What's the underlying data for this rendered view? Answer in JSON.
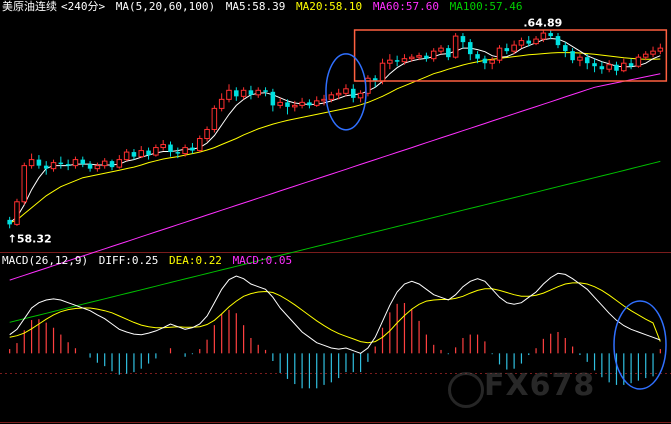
{
  "header": {
    "title": "美原油连续",
    "period": "<240分>",
    "ma_label": "MA(5,20,60,100)",
    "ma5": "MA5:58.39",
    "ma20": "MA20:58.10",
    "ma60": "MA60:57.60",
    "ma100": "MA100:57.46"
  },
  "macd_header": {
    "label": "MACD(26,12,9)",
    "diff": "DIFF:0.25",
    "dea": "DEA:0.22",
    "macd": "MACD:0.05"
  },
  "watermark": "FX678",
  "colors": {
    "up": "#ff3030",
    "down": "#00e0e0",
    "ma5": "#ffffff",
    "ma20": "#ffff00",
    "ma60": "#ff30ff",
    "ma100": "#00c000",
    "highlight_box": "#ff6040",
    "highlight_circle": "#3070ff",
    "macd_neg": "#30c0e0",
    "macd_pos": "#ff4040"
  },
  "chart_data": [
    {
      "type": "candlestick",
      "title": "美原油连续<240分>",
      "annotations": [
        {
          "text": "58.32",
          "kind": "low"
        },
        {
          "text": "64.89",
          "kind": "high"
        }
      ],
      "series": [
        {
          "name": "MA5",
          "value": 58.39
        },
        {
          "name": "MA20",
          "value": 58.1
        },
        {
          "name": "MA60",
          "value": 57.6
        },
        {
          "name": "MA100",
          "value": 57.46
        }
      ],
      "ylim": [
        57.6,
        65.3
      ],
      "candles": [
        [
          58.6,
          58.45,
          58.7,
          58.32
        ],
        [
          58.45,
          59.2,
          59.3,
          58.4
        ],
        [
          59.2,
          60.4,
          60.5,
          59.1
        ],
        [
          60.4,
          60.6,
          60.8,
          60.3
        ],
        [
          60.6,
          60.4,
          60.75,
          60.3
        ],
        [
          60.4,
          60.3,
          60.55,
          60.1
        ],
        [
          60.3,
          60.5,
          60.6,
          60.2
        ],
        [
          60.5,
          60.45,
          60.7,
          60.3
        ],
        [
          60.45,
          60.4,
          60.6,
          60.25
        ],
        [
          60.4,
          60.6,
          60.7,
          60.3
        ],
        [
          60.6,
          60.45,
          60.7,
          60.35
        ],
        [
          60.45,
          60.3,
          60.55,
          60.2
        ],
        [
          60.3,
          60.4,
          60.5,
          60.2
        ],
        [
          60.4,
          60.55,
          60.65,
          60.3
        ],
        [
          60.55,
          60.35,
          60.6,
          60.25
        ],
        [
          60.35,
          60.6,
          60.75,
          60.3
        ],
        [
          60.6,
          60.85,
          60.95,
          60.55
        ],
        [
          60.85,
          60.7,
          60.95,
          60.6
        ],
        [
          60.7,
          60.9,
          61.05,
          60.65
        ],
        [
          60.9,
          60.75,
          61.0,
          60.6
        ],
        [
          60.75,
          61.0,
          61.1,
          60.7
        ],
        [
          61.0,
          61.1,
          61.25,
          60.9
        ],
        [
          61.1,
          60.85,
          61.2,
          60.7
        ],
        [
          60.85,
          60.8,
          61.0,
          60.65
        ],
        [
          60.8,
          61.0,
          61.1,
          60.7
        ],
        [
          61.0,
          60.9,
          61.15,
          60.8
        ],
        [
          60.9,
          61.3,
          61.4,
          60.85
        ],
        [
          61.3,
          61.6,
          61.7,
          61.2
        ],
        [
          61.6,
          62.3,
          62.4,
          61.5
        ],
        [
          62.3,
          62.6,
          62.8,
          62.2
        ],
        [
          62.6,
          62.9,
          63.1,
          62.5
        ],
        [
          62.9,
          62.7,
          63.0,
          62.55
        ],
        [
          62.7,
          62.9,
          63.0,
          62.6
        ],
        [
          62.9,
          62.75,
          63.05,
          62.6
        ],
        [
          62.75,
          62.9,
          63.0,
          62.65
        ],
        [
          62.9,
          62.85,
          63.0,
          62.7
        ],
        [
          62.85,
          62.4,
          62.95,
          62.2
        ],
        [
          62.4,
          62.5,
          62.65,
          62.3
        ],
        [
          62.5,
          62.35,
          62.6,
          62.1
        ],
        [
          62.35,
          62.4,
          62.55,
          62.2
        ],
        [
          62.4,
          62.5,
          62.65,
          62.3
        ],
        [
          62.5,
          62.4,
          62.6,
          62.3
        ],
        [
          62.4,
          62.55,
          62.7,
          62.35
        ],
        [
          62.55,
          62.6,
          62.75,
          62.4
        ],
        [
          62.6,
          62.75,
          62.85,
          62.5
        ],
        [
          62.75,
          62.8,
          62.95,
          62.6
        ],
        [
          62.8,
          62.95,
          63.1,
          62.7
        ],
        [
          62.95,
          62.65,
          63.1,
          62.5
        ],
        [
          62.65,
          62.8,
          62.9,
          62.5
        ],
        [
          62.8,
          63.3,
          63.4,
          62.7
        ],
        [
          63.3,
          63.2,
          63.4,
          63.0
        ],
        [
          63.2,
          63.8,
          63.95,
          63.1
        ],
        [
          63.8,
          63.9,
          64.1,
          63.6
        ],
        [
          63.9,
          63.85,
          64.05,
          63.7
        ],
        [
          63.85,
          63.95,
          64.1,
          63.75
        ],
        [
          63.95,
          64.0,
          64.1,
          63.85
        ],
        [
          64.0,
          64.05,
          64.15,
          63.9
        ],
        [
          64.05,
          63.95,
          64.15,
          63.85
        ],
        [
          63.95,
          64.2,
          64.3,
          63.85
        ],
        [
          64.2,
          64.3,
          64.4,
          64.1
        ],
        [
          64.3,
          64.0,
          64.4,
          63.9
        ],
        [
          64.0,
          64.7,
          64.8,
          63.95
        ],
        [
          64.7,
          64.5,
          64.8,
          64.3
        ],
        [
          64.5,
          64.1,
          64.6,
          63.9
        ],
        [
          64.1,
          63.95,
          64.2,
          63.8
        ],
        [
          63.95,
          63.8,
          64.05,
          63.6
        ],
        [
          63.8,
          63.9,
          64.0,
          63.6
        ],
        [
          63.9,
          64.3,
          64.4,
          63.8
        ],
        [
          64.3,
          64.2,
          64.45,
          64.1
        ],
        [
          64.2,
          64.4,
          64.55,
          64.1
        ],
        [
          64.4,
          64.55,
          64.65,
          64.3
        ],
        [
          64.55,
          64.45,
          64.7,
          64.35
        ],
        [
          64.45,
          64.6,
          64.7,
          64.4
        ],
        [
          64.6,
          64.8,
          64.89,
          64.5
        ],
        [
          64.8,
          64.7,
          64.89,
          64.6
        ],
        [
          64.7,
          64.4,
          64.8,
          64.3
        ],
        [
          64.4,
          64.2,
          64.5,
          64.0
        ],
        [
          64.2,
          63.9,
          64.3,
          63.8
        ],
        [
          63.9,
          64.0,
          64.1,
          63.7
        ],
        [
          64.0,
          63.8,
          64.1,
          63.6
        ],
        [
          63.8,
          63.7,
          63.95,
          63.5
        ],
        [
          63.7,
          63.6,
          63.85,
          63.45
        ],
        [
          63.6,
          63.75,
          63.9,
          63.5
        ],
        [
          63.75,
          63.55,
          63.85,
          63.4
        ],
        [
          63.55,
          63.8,
          63.95,
          63.5
        ],
        [
          63.8,
          63.7,
          63.95,
          63.6
        ],
        [
          63.7,
          64.0,
          64.1,
          63.65
        ],
        [
          64.0,
          64.1,
          64.2,
          63.9
        ],
        [
          64.1,
          64.2,
          64.35,
          64.0
        ],
        [
          64.2,
          64.3,
          64.45,
          64.1
        ]
      ],
      "ma5": [
        58.5,
        58.7,
        59.1,
        59.6,
        60.0,
        60.3,
        60.4,
        60.4,
        60.4,
        60.45,
        60.45,
        60.45,
        60.42,
        60.42,
        60.42,
        60.45,
        60.55,
        60.6,
        60.68,
        60.75,
        60.82,
        60.87,
        60.87,
        60.9,
        60.95,
        60.95,
        61.0,
        61.15,
        61.4,
        61.75,
        62.1,
        62.4,
        62.6,
        62.75,
        62.8,
        62.82,
        62.75,
        62.65,
        62.55,
        62.48,
        62.45,
        62.43,
        62.44,
        62.48,
        62.55,
        62.63,
        62.72,
        62.75,
        62.78,
        62.88,
        63.0,
        63.2,
        63.45,
        63.65,
        63.8,
        63.88,
        63.93,
        63.96,
        64.02,
        64.1,
        64.12,
        64.2,
        64.3,
        64.3,
        64.25,
        64.18,
        64.05,
        64.0,
        64.02,
        64.12,
        64.28,
        64.38,
        64.48,
        64.58,
        64.62,
        64.6,
        64.5,
        64.35,
        64.2,
        64.05,
        63.95,
        63.85,
        63.78,
        63.7,
        63.68,
        63.68,
        63.72,
        63.8,
        63.95,
        64.05
      ],
      "ma20": [
        58.5,
        58.6,
        58.8,
        59.0,
        59.2,
        59.4,
        59.55,
        59.7,
        59.8,
        59.9,
        60.0,
        60.05,
        60.1,
        60.15,
        60.2,
        60.25,
        60.3,
        60.35,
        60.42,
        60.5,
        60.56,
        60.62,
        60.66,
        60.7,
        60.75,
        60.8,
        60.85,
        60.92,
        61.0,
        61.1,
        61.2,
        61.3,
        61.42,
        61.52,
        61.62,
        61.7,
        61.78,
        61.84,
        61.9,
        61.95,
        62.0,
        62.05,
        62.1,
        62.15,
        62.2,
        62.25,
        62.3,
        62.35,
        62.42,
        62.5,
        62.6,
        62.7,
        62.82,
        62.95,
        63.05,
        63.15,
        63.25,
        63.35,
        63.45,
        63.52,
        63.6,
        63.67,
        63.74,
        63.8,
        63.85,
        63.9,
        63.93,
        63.96,
        63.99,
        64.02,
        64.05,
        64.08,
        64.1,
        64.12,
        64.14,
        64.15,
        64.15,
        64.15,
        64.14,
        64.12,
        64.1,
        64.07,
        64.04,
        64.01,
        63.98,
        63.96,
        63.94,
        63.93,
        63.93,
        63.94
      ],
      "ma60": [
        56.6,
        56.68,
        56.76,
        56.84,
        56.92,
        57.0,
        57.08,
        57.16,
        57.24,
        57.32,
        57.4,
        57.48,
        57.56,
        57.64,
        57.72,
        57.8,
        57.88,
        57.96,
        58.04,
        58.12,
        58.2,
        58.28,
        58.36,
        58.44,
        58.52,
        58.6,
        58.68,
        58.76,
        58.84,
        58.92,
        59.0,
        59.08,
        59.16,
        59.24,
        59.32,
        59.4,
        59.48,
        59.56,
        59.64,
        59.72,
        59.8,
        59.88,
        59.96,
        60.04,
        60.12,
        60.2,
        60.28,
        60.36,
        60.44,
        60.52,
        60.6,
        60.68,
        60.76,
        60.84,
        60.92,
        61.0,
        61.08,
        61.16,
        61.24,
        61.32,
        61.4,
        61.48,
        61.56,
        61.64,
        61.72,
        61.8,
        61.88,
        61.96,
        62.04,
        62.12,
        62.2,
        62.28,
        62.36,
        62.44,
        62.52,
        62.6,
        62.68,
        62.76,
        62.84,
        62.92,
        63.0,
        63.05,
        63.1,
        63.15,
        63.2,
        63.25,
        63.3,
        63.35,
        63.4,
        63.45
      ],
      "ma100": [
        55.2,
        55.26,
        55.32,
        55.38,
        55.44,
        55.5,
        55.56,
        55.62,
        55.68,
        55.74,
        55.8,
        55.86,
        55.92,
        55.98,
        56.04,
        56.1,
        56.16,
        56.22,
        56.28,
        56.34,
        56.4,
        56.46,
        56.52,
        56.58,
        56.64,
        56.7,
        56.76,
        56.82,
        56.88,
        56.94,
        57.0,
        57.06,
        57.12,
        57.18,
        57.24,
        57.3,
        57.36,
        57.42,
        57.48,
        57.54,
        57.6,
        57.66,
        57.72,
        57.78,
        57.84,
        57.9,
        57.96,
        58.02,
        58.08,
        58.14,
        58.2,
        58.26,
        58.32,
        58.38,
        58.44,
        58.5,
        58.56,
        58.62,
        58.68,
        58.74,
        58.8,
        58.86,
        58.92,
        58.98,
        59.04,
        59.1,
        59.16,
        59.22,
        59.28,
        59.34,
        59.4,
        59.46,
        59.52,
        59.58,
        59.64,
        59.7,
        59.76,
        59.82,
        59.88,
        59.94,
        60.0,
        60.06,
        60.12,
        60.18,
        60.24,
        60.3,
        60.36,
        60.42,
        60.48,
        60.54
      ]
    },
    {
      "type": "line",
      "title": "MACD(26,12,9)",
      "series": [
        {
          "name": "DIFF",
          "last": 0.25
        },
        {
          "name": "DEA",
          "last": 0.22
        },
        {
          "name": "MACD",
          "last": 0.05
        }
      ],
      "ylim": [
        -1.1,
        1.6
      ],
      "diff": [
        0.35,
        0.45,
        0.65,
        0.85,
        0.95,
        1.0,
        1.02,
        1.0,
        0.95,
        0.9,
        0.85,
        0.8,
        0.72,
        0.65,
        0.55,
        0.45,
        0.4,
        0.36,
        0.35,
        0.38,
        0.42,
        0.48,
        0.55,
        0.5,
        0.45,
        0.48,
        0.55,
        0.7,
        0.95,
        1.2,
        1.38,
        1.45,
        1.4,
        1.3,
        1.25,
        1.2,
        1.05,
        0.85,
        0.7,
        0.55,
        0.4,
        0.3,
        0.2,
        0.15,
        0.1,
        0.08,
        0.1,
        0.05,
        0.0,
        0.1,
        0.3,
        0.6,
        0.9,
        1.15,
        1.3,
        1.35,
        1.3,
        1.2,
        1.1,
        1.05,
        1.0,
        1.1,
        1.25,
        1.35,
        1.4,
        1.35,
        1.2,
        1.05,
        0.95,
        0.92,
        0.95,
        1.05,
        1.15,
        1.3,
        1.42,
        1.5,
        1.48,
        1.4,
        1.3,
        1.2,
        1.05,
        0.9,
        0.75,
        0.62,
        0.52,
        0.45,
        0.4,
        0.35,
        0.3,
        0.25
      ],
      "dea": [
        0.3,
        0.33,
        0.38,
        0.46,
        0.55,
        0.64,
        0.72,
        0.78,
        0.82,
        0.84,
        0.85,
        0.85,
        0.83,
        0.8,
        0.76,
        0.7,
        0.64,
        0.58,
        0.53,
        0.5,
        0.48,
        0.48,
        0.49,
        0.5,
        0.49,
        0.49,
        0.5,
        0.54,
        0.62,
        0.74,
        0.87,
        0.98,
        1.07,
        1.12,
        1.15,
        1.16,
        1.14,
        1.08,
        1.0,
        0.91,
        0.81,
        0.71,
        0.61,
        0.52,
        0.44,
        0.37,
        0.32,
        0.27,
        0.22,
        0.2,
        0.22,
        0.3,
        0.42,
        0.57,
        0.71,
        0.83,
        0.92,
        0.98,
        1.0,
        1.01,
        1.01,
        1.03,
        1.07,
        1.13,
        1.18,
        1.21,
        1.21,
        1.18,
        1.14,
        1.1,
        1.07,
        1.07,
        1.09,
        1.13,
        1.19,
        1.25,
        1.3,
        1.32,
        1.32,
        1.3,
        1.25,
        1.18,
        1.09,
        0.99,
        0.89,
        0.8,
        0.72,
        0.64,
        0.57,
        0.22
      ],
      "macd": [
        0.05,
        0.12,
        0.27,
        0.39,
        0.4,
        0.36,
        0.3,
        0.22,
        0.13,
        0.06,
        0.0,
        -0.05,
        -0.11,
        -0.15,
        -0.21,
        -0.25,
        -0.24,
        -0.22,
        -0.18,
        -0.12,
        -0.06,
        0.0,
        0.06,
        0.0,
        -0.04,
        -0.01,
        0.05,
        0.16,
        0.33,
        0.46,
        0.51,
        0.47,
        0.33,
        0.18,
        0.1,
        0.04,
        -0.09,
        -0.23,
        -0.3,
        -0.36,
        -0.41,
        -0.41,
        -0.41,
        -0.37,
        -0.34,
        -0.29,
        -0.22,
        -0.22,
        -0.22,
        -0.1,
        0.08,
        0.3,
        0.48,
        0.58,
        0.59,
        0.52,
        0.38,
        0.22,
        0.1,
        0.04,
        -0.01,
        0.07,
        0.18,
        0.22,
        0.22,
        0.14,
        -0.01,
        -0.13,
        -0.19,
        -0.18,
        -0.12,
        -0.02,
        0.06,
        0.17,
        0.23,
        0.25,
        0.18,
        0.08,
        -0.02,
        -0.1,
        -0.2,
        -0.28,
        -0.34,
        -0.37,
        -0.37,
        -0.35,
        -0.32,
        -0.29,
        -0.27,
        0.05
      ]
    }
  ]
}
